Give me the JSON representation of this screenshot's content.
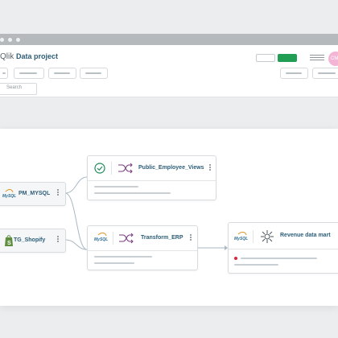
{
  "app": {
    "logo_text": "Qlik",
    "project_title": "Data project",
    "avatar_initials": "CM"
  },
  "search": {
    "placeholder": "Search"
  },
  "nodes": {
    "pm_mysql": {
      "label": "PM_MYSQL",
      "icon_text": "MySQL"
    },
    "tg_shopify": {
      "label": "TG_Shopify"
    },
    "public_employee_views": {
      "label": "Public_Employee_Views"
    },
    "transform_erp": {
      "label": "Transform_ERP",
      "icon_text": "MySQL"
    },
    "revenue_data_mart": {
      "label": "Revenue data mart",
      "icon_text": "MySQL"
    }
  },
  "colors": {
    "accent": "#2c5d78",
    "primary_button": "#1f9e54",
    "connector": "#a9b8c4",
    "error_dot": "#e0243a",
    "success_check": "#1f8a5a"
  }
}
